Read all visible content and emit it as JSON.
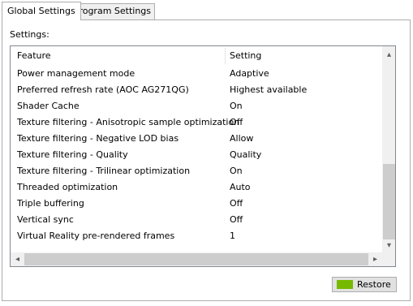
{
  "tabs": [
    {
      "label": "Global Settings",
      "active": true
    },
    {
      "label": "Program Settings",
      "active": false
    }
  ],
  "settings_label": "Settings:",
  "table": {
    "columns": [
      "Feature",
      "Setting"
    ],
    "rows": [
      {
        "feature": "Power management mode",
        "setting": "Adaptive"
      },
      {
        "feature": "Preferred refresh rate (AOC AG271QG)",
        "setting": "Highest available"
      },
      {
        "feature": "Shader Cache",
        "setting": "On"
      },
      {
        "feature": "Texture filtering - Anisotropic sample optimization",
        "setting": "Off"
      },
      {
        "feature": "Texture filtering - Negative LOD bias",
        "setting": "Allow"
      },
      {
        "feature": "Texture filtering - Quality",
        "setting": "Quality"
      },
      {
        "feature": "Texture filtering - Trilinear optimization",
        "setting": "On"
      },
      {
        "feature": "Threaded optimization",
        "setting": "Auto"
      },
      {
        "feature": "Triple buffering",
        "setting": "Off"
      },
      {
        "feature": "Vertical sync",
        "setting": "Off"
      },
      {
        "feature": "Virtual Reality pre-rendered frames",
        "setting": "1"
      }
    ]
  },
  "restore_button": {
    "label": "Restore",
    "icon": "nvidia-logo-icon",
    "accent": "#76b900"
  }
}
